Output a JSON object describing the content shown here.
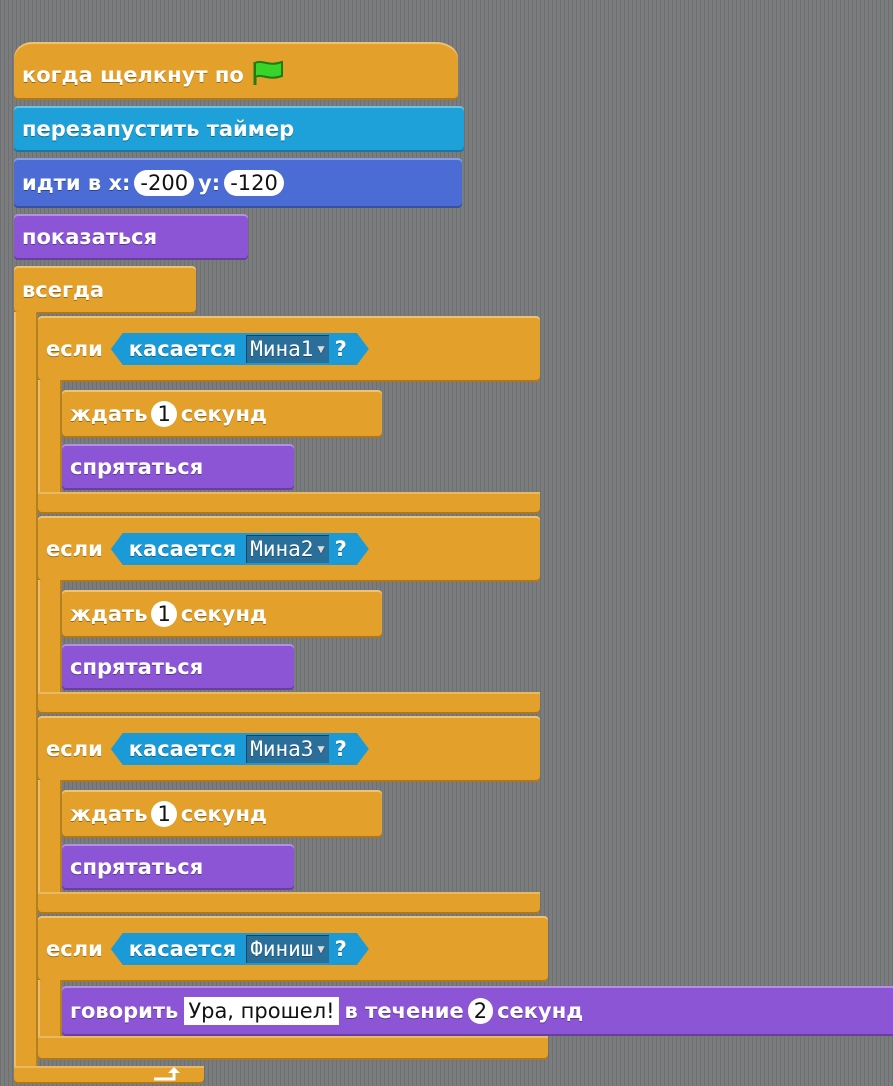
{
  "script": {
    "hat": {
      "label": "когда щелкнут по",
      "icon": "green-flag-icon"
    },
    "reset_timer": "перезапустить таймер",
    "goto": {
      "label_go": "идти в x:",
      "x": "-200",
      "label_y": "y:",
      "y": "-120"
    },
    "show": "показаться",
    "forever": "всегда",
    "if_blocks": [
      {
        "if_label": "если",
        "touching_label": "касается",
        "target": "Мина1",
        "q": "?",
        "wait_label": "ждать",
        "wait_value": "1",
        "wait_unit": "секунд",
        "hide": "спрятаться"
      },
      {
        "if_label": "если",
        "touching_label": "касается",
        "target": "Мина2",
        "q": "?",
        "wait_label": "ждать",
        "wait_value": "1",
        "wait_unit": "секунд",
        "hide": "спрятаться"
      },
      {
        "if_label": "если",
        "touching_label": "касается",
        "target": "Мина3",
        "q": "?",
        "wait_label": "ждать",
        "wait_value": "1",
        "wait_unit": "секунд",
        "hide": "спрятаться"
      }
    ],
    "finish_if": {
      "if_label": "если",
      "touching_label": "касается",
      "target": "Финиш",
      "q": "?",
      "say_label": "говорить",
      "say_text": "Ура, прошел!",
      "for_label": "в течение",
      "secs": "2",
      "secs_unit": "секунд"
    }
  },
  "colors": {
    "control": "#e3a12b",
    "sound": "#1ea0d8",
    "motion": "#4a6cd4",
    "looks": "#8b55d6",
    "sensing": "#1a9ad6",
    "background": "#7b7c7e"
  }
}
